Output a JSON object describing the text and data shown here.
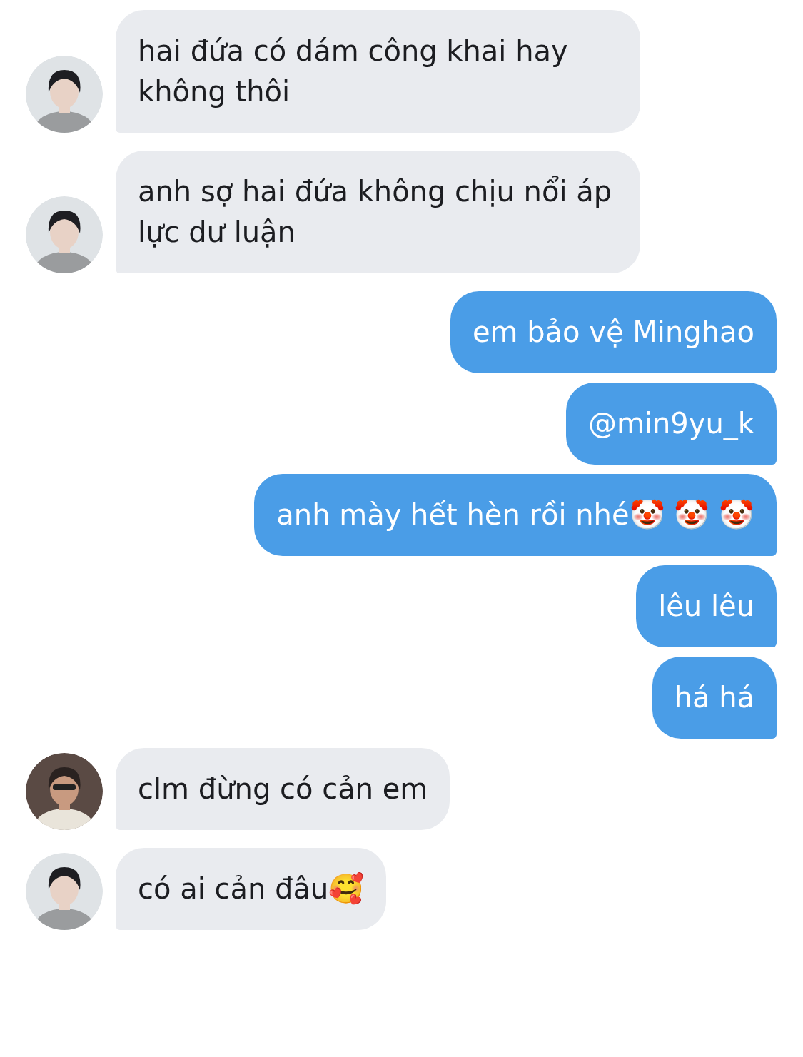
{
  "messages": [
    {
      "kind": "incoming",
      "text": "hai đứa có dám công khai hay không thôi"
    },
    {
      "kind": "incoming",
      "text": "anh sợ hai đứa không chịu nổi áp lực dư luận"
    },
    {
      "kind": "outgoing",
      "text": "em bảo vệ Minghao"
    },
    {
      "kind": "outgoing",
      "text": "@min9yu_k"
    },
    {
      "kind": "outgoing",
      "text": "anh mày hết hèn rồi nhé🤡 🤡 🤡"
    },
    {
      "kind": "outgoing",
      "text": "lêu lêu"
    },
    {
      "kind": "outgoing",
      "text": "há há"
    },
    {
      "kind": "incoming",
      "text": "clm đừng có cản em"
    },
    {
      "kind": "incoming",
      "text": "có ai cản đâu🥰"
    }
  ]
}
